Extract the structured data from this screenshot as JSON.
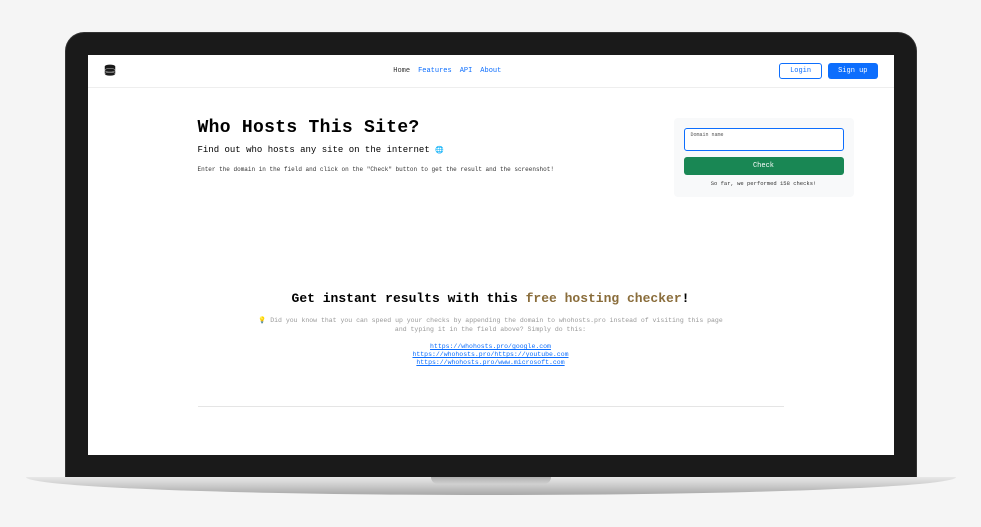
{
  "nav": {
    "home": "Home",
    "features": "Features",
    "api": "API",
    "about": "About",
    "login": "Login",
    "signup": "Sign up"
  },
  "hero": {
    "title": "Who Hosts This Site?",
    "subtitle": "Find out who hosts any site on the internet",
    "globe": "🌐",
    "desc": "Enter the domain in the field and click on the \"Check\" button to get the result and the screenshot!"
  },
  "check": {
    "input_label": "Domain name",
    "input_value": "",
    "button": "Check",
    "count": "So far, we performed 158 checks!"
  },
  "info": {
    "title_part1": "Get instant results with this ",
    "title_highlight": "free hosting checker",
    "title_part2": "!",
    "tip_icon": "💡",
    "tip_text": " Did you know that you can speed up your checks by appending the domain to whohosts.pro instead of visiting this page and typing it in the field above? Simply do this:",
    "examples": {
      "ex1": "https://whohosts.pro/google.com",
      "ex2": "https://whohosts.pro/https://youtube.com",
      "ex3": "https://whohosts.pro/www.microsoft.com"
    }
  }
}
